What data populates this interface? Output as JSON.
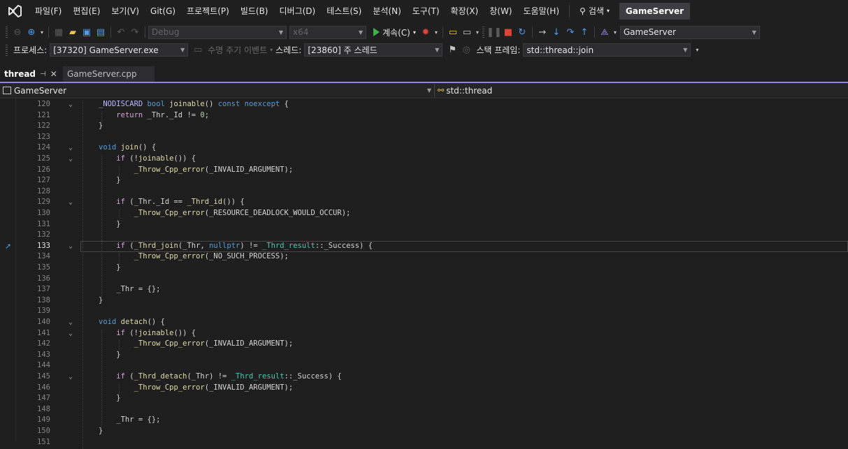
{
  "menu": {
    "items": [
      "파일(F)",
      "편집(E)",
      "보기(V)",
      "Git(G)",
      "프로젝트(P)",
      "빌드(B)",
      "디버그(D)",
      "테스트(S)",
      "분석(N)",
      "도구(T)",
      "확장(X)",
      "창(W)",
      "도움말(H)"
    ],
    "search_label": "검색",
    "solution_name": "GameServer"
  },
  "toolbar1": {
    "config": "Debug",
    "platform": "x64",
    "continue_label": "계속(C)",
    "startup_project": "GameServer"
  },
  "toolbar2": {
    "process_label": "프로세스:",
    "process_value": "[37320] GameServer.exe",
    "lifecycle_label": "수명 주기 이벤트",
    "thread_label": "스레드:",
    "thread_value": "[23860] 주 스레드",
    "stackframe_label": "스택 프레임:",
    "stackframe_value": "std::thread::join"
  },
  "tabs": [
    {
      "label": "thread",
      "active": true
    },
    {
      "label": "GameServer.cpp",
      "active": false
    }
  ],
  "navbar": {
    "project": "GameServer",
    "scope": "std::thread"
  },
  "editor": {
    "current_line": 133,
    "lines": [
      {
        "n": 120,
        "fold": true,
        "tokens": [
          [
            "mac",
            "_NODISCARD"
          ],
          [
            "pl",
            " "
          ],
          [
            "kw",
            "bool"
          ],
          [
            "pl",
            " "
          ],
          [
            "fn",
            "joinable"
          ],
          [
            "pl",
            "() "
          ],
          [
            "kw",
            "const"
          ],
          [
            "pl",
            " "
          ],
          [
            "kw",
            "noexcept"
          ],
          [
            "pl",
            " {"
          ]
        ]
      },
      {
        "n": 121,
        "fold": false,
        "tokens": [
          [
            "pl",
            "    "
          ],
          [
            "kw2",
            "return"
          ],
          [
            "pl",
            " _Thr._Id != "
          ],
          [
            "num",
            "0"
          ],
          [
            "pl",
            ";"
          ]
        ]
      },
      {
        "n": 122,
        "fold": false,
        "tokens": [
          [
            "pl",
            "}"
          ]
        ]
      },
      {
        "n": 123,
        "fold": false,
        "tokens": []
      },
      {
        "n": 124,
        "fold": true,
        "tokens": [
          [
            "kw",
            "void"
          ],
          [
            "pl",
            " "
          ],
          [
            "fn",
            "join"
          ],
          [
            "pl",
            "() {"
          ]
        ]
      },
      {
        "n": 125,
        "fold": true,
        "tokens": [
          [
            "pl",
            "    "
          ],
          [
            "kw2",
            "if"
          ],
          [
            "pl",
            " (!"
          ],
          [
            "fn",
            "joinable"
          ],
          [
            "pl",
            "()) {"
          ]
        ]
      },
      {
        "n": 126,
        "fold": false,
        "tokens": [
          [
            "pl",
            "        "
          ],
          [
            "fn",
            "_Throw_Cpp_error"
          ],
          [
            "pl",
            "(_INVALID_ARGUMENT);"
          ]
        ]
      },
      {
        "n": 127,
        "fold": false,
        "tokens": [
          [
            "pl",
            "    }"
          ]
        ]
      },
      {
        "n": 128,
        "fold": false,
        "tokens": []
      },
      {
        "n": 129,
        "fold": true,
        "tokens": [
          [
            "pl",
            "    "
          ],
          [
            "kw2",
            "if"
          ],
          [
            "pl",
            " (_Thr._Id == "
          ],
          [
            "fn",
            "_Thrd_id"
          ],
          [
            "pl",
            "()) {"
          ]
        ]
      },
      {
        "n": 130,
        "fold": false,
        "tokens": [
          [
            "pl",
            "        "
          ],
          [
            "fn",
            "_Throw_Cpp_error"
          ],
          [
            "pl",
            "(_RESOURCE_DEADLOCK_WOULD_OCCUR);"
          ]
        ]
      },
      {
        "n": 131,
        "fold": false,
        "tokens": [
          [
            "pl",
            "    }"
          ]
        ]
      },
      {
        "n": 132,
        "fold": false,
        "tokens": []
      },
      {
        "n": 133,
        "fold": true,
        "tokens": [
          [
            "pl",
            "    "
          ],
          [
            "kw2",
            "if"
          ],
          [
            "pl",
            " ("
          ],
          [
            "fn",
            "_Thrd_join"
          ],
          [
            "pl",
            "(_Thr, "
          ],
          [
            "kw",
            "nullptr"
          ],
          [
            "pl",
            ") != "
          ],
          [
            "en",
            "_Thrd_result"
          ],
          [
            "pl",
            "::_Success) {"
          ]
        ]
      },
      {
        "n": 134,
        "fold": false,
        "tokens": [
          [
            "pl",
            "        "
          ],
          [
            "fn",
            "_Throw_Cpp_error"
          ],
          [
            "pl",
            "(_NO_SUCH_PROCESS);"
          ]
        ]
      },
      {
        "n": 135,
        "fold": false,
        "tokens": [
          [
            "pl",
            "    }"
          ]
        ]
      },
      {
        "n": 136,
        "fold": false,
        "tokens": []
      },
      {
        "n": 137,
        "fold": false,
        "tokens": [
          [
            "pl",
            "    _Thr = {};"
          ]
        ]
      },
      {
        "n": 138,
        "fold": false,
        "tokens": [
          [
            "pl",
            "}"
          ]
        ]
      },
      {
        "n": 139,
        "fold": false,
        "tokens": []
      },
      {
        "n": 140,
        "fold": true,
        "tokens": [
          [
            "kw",
            "void"
          ],
          [
            "pl",
            " "
          ],
          [
            "fn",
            "detach"
          ],
          [
            "pl",
            "() {"
          ]
        ]
      },
      {
        "n": 141,
        "fold": true,
        "tokens": [
          [
            "pl",
            "    "
          ],
          [
            "kw2",
            "if"
          ],
          [
            "pl",
            " (!"
          ],
          [
            "fn",
            "joinable"
          ],
          [
            "pl",
            "()) {"
          ]
        ]
      },
      {
        "n": 142,
        "fold": false,
        "tokens": [
          [
            "pl",
            "        "
          ],
          [
            "fn",
            "_Throw_Cpp_error"
          ],
          [
            "pl",
            "(_INVALID_ARGUMENT);"
          ]
        ]
      },
      {
        "n": 143,
        "fold": false,
        "tokens": [
          [
            "pl",
            "    }"
          ]
        ]
      },
      {
        "n": 144,
        "fold": false,
        "tokens": []
      },
      {
        "n": 145,
        "fold": true,
        "tokens": [
          [
            "pl",
            "    "
          ],
          [
            "kw2",
            "if"
          ],
          [
            "pl",
            " ("
          ],
          [
            "fn",
            "_Thrd_detach"
          ],
          [
            "pl",
            "(_Thr) != "
          ],
          [
            "en",
            "_Thrd_result"
          ],
          [
            "pl",
            "::_Success) {"
          ]
        ]
      },
      {
        "n": 146,
        "fold": false,
        "tokens": [
          [
            "pl",
            "        "
          ],
          [
            "fn",
            "_Throw_Cpp_error"
          ],
          [
            "pl",
            "(_INVALID_ARGUMENT);"
          ]
        ]
      },
      {
        "n": 147,
        "fold": false,
        "tokens": [
          [
            "pl",
            "    }"
          ]
        ]
      },
      {
        "n": 148,
        "fold": false,
        "tokens": []
      },
      {
        "n": 149,
        "fold": false,
        "tokens": [
          [
            "pl",
            "    _Thr = {};"
          ]
        ]
      },
      {
        "n": 150,
        "fold": false,
        "tokens": [
          [
            "pl",
            "}"
          ]
        ]
      },
      {
        "n": 151,
        "fold": false,
        "tokens": []
      }
    ]
  }
}
